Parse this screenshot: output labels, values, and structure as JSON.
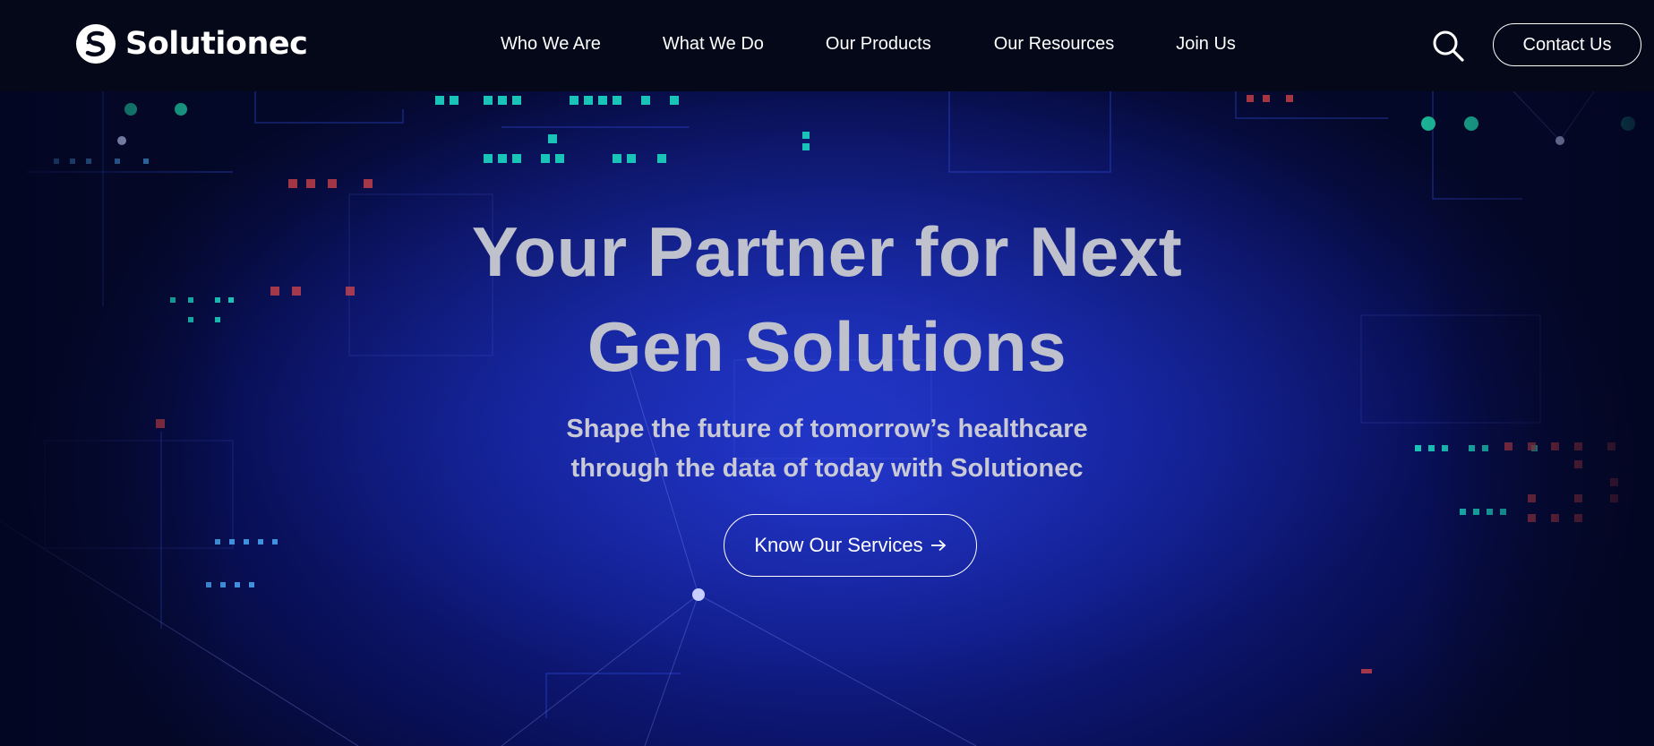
{
  "header": {
    "logo_text": "Solutionec",
    "nav": [
      {
        "label": "Who We Are"
      },
      {
        "label": "What We Do"
      },
      {
        "label": "Our Products"
      },
      {
        "label": "Our Resources"
      },
      {
        "label": "Join Us"
      }
    ],
    "search_icon": "search-icon",
    "contact_label": "Contact Us"
  },
  "hero": {
    "headline_line1": "Your Partner for Next",
    "headline_line2": "Gen Solutions",
    "subline_line1": "Shape the future of tomorrow’s healthcare",
    "subline_line2": "through the data of today with Solutionec",
    "cta_label": "Know Our Services",
    "cta_icon": "arrow-right-icon"
  },
  "colors": {
    "header_bg": "#050818",
    "hero_bg": "#0c188a",
    "text": "#ffffff",
    "headline": "#bfc1cc"
  }
}
